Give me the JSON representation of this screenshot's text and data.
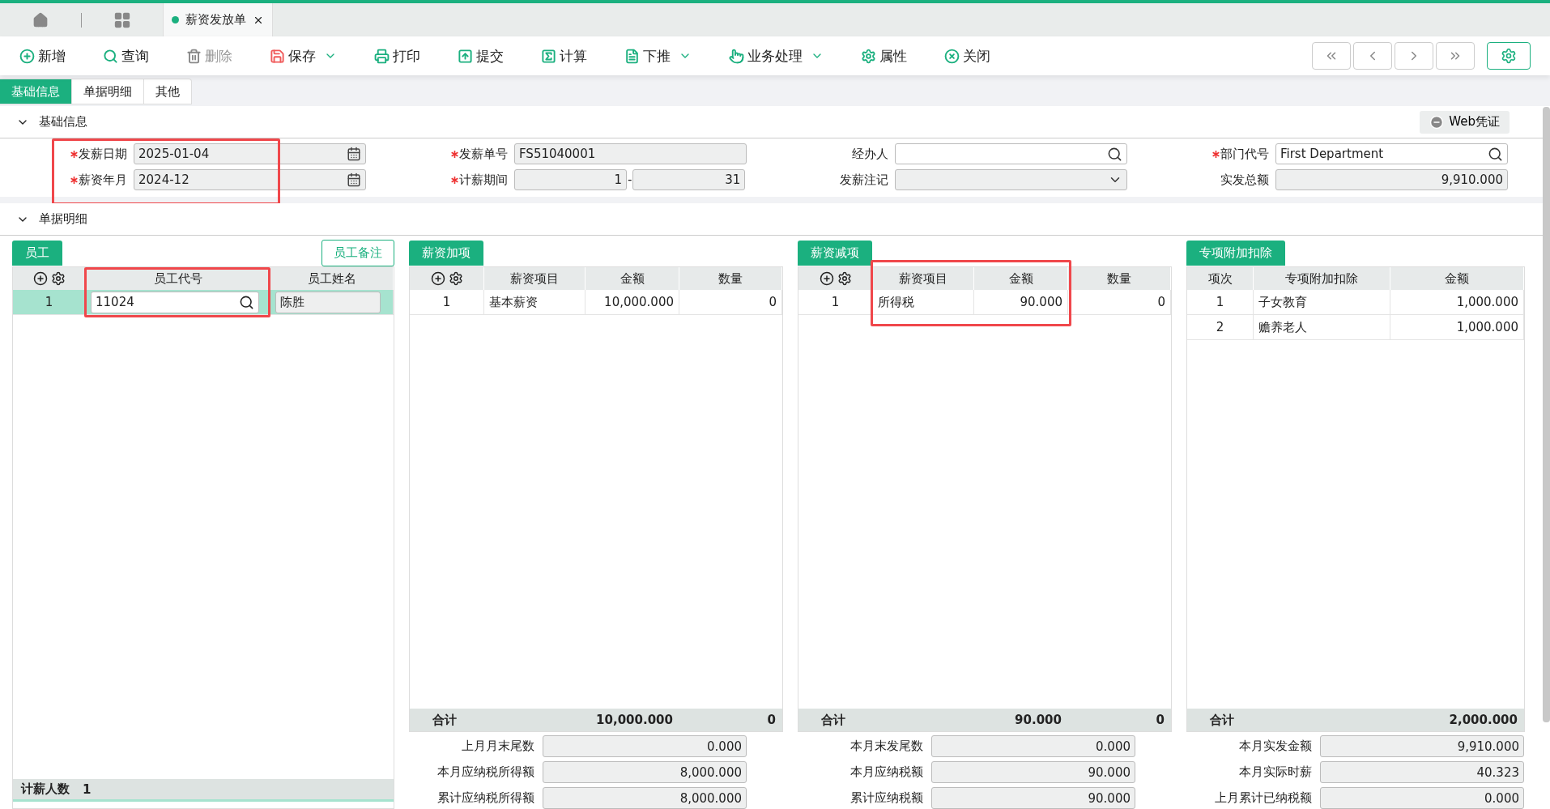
{
  "doc_tabs": [
    {
      "label": "薪资发放单",
      "selected": true
    }
  ],
  "toolbar": {
    "buttons": [
      {
        "label": "新增",
        "disabled": false,
        "dropdown": false
      },
      {
        "label": "查询",
        "disabled": false,
        "dropdown": false
      },
      {
        "label": "删除",
        "disabled": true,
        "dropdown": false
      },
      {
        "label": "保存",
        "disabled": false,
        "dropdown": true
      },
      {
        "label": "打印",
        "disabled": false,
        "dropdown": false
      },
      {
        "label": "提交",
        "disabled": false,
        "dropdown": false
      },
      {
        "label": "计算",
        "disabled": false,
        "dropdown": false
      },
      {
        "label": "下推",
        "disabled": false,
        "dropdown": true
      },
      {
        "label": "业务处理",
        "disabled": false,
        "dropdown": true
      },
      {
        "label": "属性",
        "disabled": false,
        "dropdown": false
      },
      {
        "label": "关闭",
        "disabled": false,
        "dropdown": false
      }
    ]
  },
  "sub_tabs": [
    {
      "label": "基础信息",
      "selected": true
    },
    {
      "label": "单据明细",
      "selected": false
    },
    {
      "label": "其他",
      "selected": false
    }
  ],
  "basic_section": {
    "title": "基础信息",
    "web_button": "Web凭证",
    "fields": [
      {
        "kind": "date",
        "label": "发薪日期",
        "required": true,
        "value": "2025-01-04"
      },
      {
        "kind": "text",
        "label": "发薪单号",
        "required": true,
        "value": "FS51040001"
      },
      {
        "kind": "search",
        "label": "经办人",
        "required": false
      },
      {
        "kind": "search",
        "label": "部门代号",
        "required": true,
        "value": "First Department"
      },
      {
        "kind": "date",
        "label": "薪资年月",
        "required": true,
        "value": "2024-12"
      },
      {
        "kind": "range",
        "label": "计薪期间",
        "required": true,
        "value_from": "1",
        "separator": "-",
        "value_to": "31"
      },
      {
        "kind": "select",
        "label": "发薪注记",
        "required": false
      },
      {
        "kind": "number",
        "label": "实发总额",
        "required": false,
        "value": "9,910.000"
      }
    ]
  },
  "detail_section": {
    "title": "单据明细"
  },
  "employee_panel": {
    "tab": "员工",
    "note_button": "员工备注",
    "columns": [
      "员工代号",
      "员工姓名"
    ],
    "rows": [
      {
        "index": "1",
        "code": "11024",
        "name": "陈胜",
        "selected": true
      }
    ],
    "footer_label": "计薪人数",
    "footer_value": "1"
  },
  "item_panels": [
    {
      "title": "薪资加项",
      "tools": true,
      "columns": [
        "薪资项目",
        "金额",
        "数量"
      ],
      "rows": [
        {
          "index": "1",
          "cells": [
            "基本薪资",
            "10,000.000",
            "0"
          ]
        }
      ],
      "total": {
        "label": "合计",
        "cells": [
          "10,000.000",
          "0"
        ]
      },
      "fields": [
        {
          "label": "上月月末尾数",
          "value": "0.000"
        },
        {
          "label": "本月应纳税所得额",
          "value": "8,000.000"
        },
        {
          "label": "累计应纳税所得额",
          "value": "8,000.000"
        }
      ]
    },
    {
      "title": "薪资减项",
      "tools": true,
      "columns": [
        "薪资项目",
        "金额",
        "数量"
      ],
      "rows": [
        {
          "index": "1",
          "cells": [
            "所得税",
            "90.000",
            "0"
          ]
        }
      ],
      "total": {
        "label": "合计",
        "cells": [
          "90.000",
          "0"
        ]
      },
      "fields": [
        {
          "label": "本月末发尾数",
          "value": "0.000"
        },
        {
          "label": "本月应纳税额",
          "value": "90.000"
        },
        {
          "label": "累计应纳税额",
          "value": "90.000"
        }
      ]
    },
    {
      "title": "专项附加扣除",
      "tools": false,
      "columns": [
        "项次",
        "专项附加扣除",
        "金额"
      ],
      "rows": [
        {
          "index": "1",
          "cells": [
            "子女教育",
            "1,000.000"
          ]
        },
        {
          "index": "2",
          "cells": [
            "赡养老人",
            "1,000.000"
          ]
        }
      ],
      "total": {
        "label": "合计",
        "cells": [
          "2,000.000"
        ]
      },
      "fields": [
        {
          "label": "本月实发金额",
          "value": "9,910.000"
        },
        {
          "label": "本月实际时薪",
          "value": "40.323"
        },
        {
          "label": "上月累计已纳税额",
          "value": "0.000"
        }
      ]
    }
  ]
}
